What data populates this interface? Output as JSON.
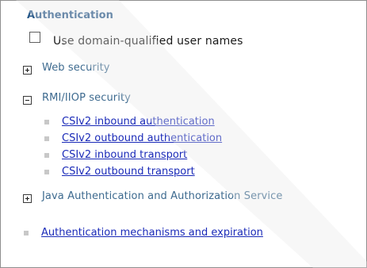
{
  "section": {
    "title": "Authentication"
  },
  "checkbox": {
    "label": "Use domain-qualified user names",
    "checked": false
  },
  "groups": {
    "web_security": {
      "label": "Web security",
      "expanded": false
    },
    "rmi_iiop_security": {
      "label": "RMI/IIOP security",
      "expanded": true,
      "links": [
        "CSIv2 inbound authentication",
        "CSIv2 outbound authentication",
        "CSIv2 inbound transport",
        "CSIv2 outbound transport"
      ]
    },
    "jaas": {
      "label": "Java Authentication and Authorization Service",
      "expanded": false
    }
  },
  "bottom_link": {
    "label": "Authentication mechanisms and expiration"
  },
  "colors": {
    "title": "#2a5a8a",
    "group_label": "#3d6a8f",
    "link": "#1a2ab8",
    "bullet": "#c8c8c8",
    "border": "#8f8f8f"
  }
}
